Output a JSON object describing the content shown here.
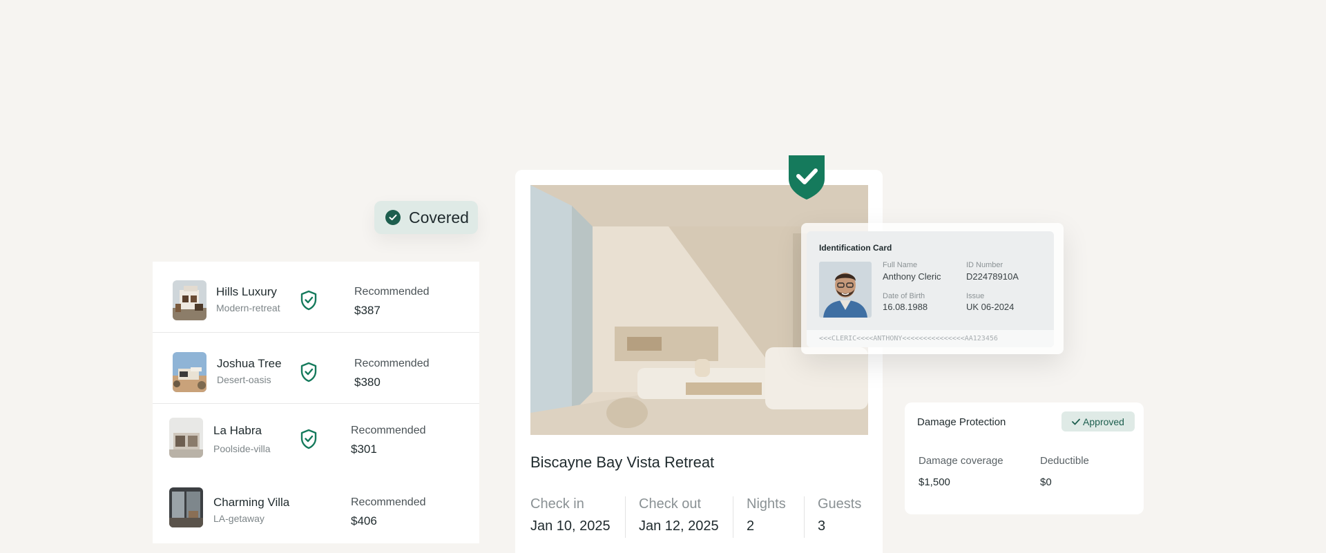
{
  "covered": {
    "label": "Covered"
  },
  "listings": [
    {
      "name": "Hills Luxury",
      "subtitle": "Modern-retreat",
      "recommended": "Recommended",
      "price": "$387",
      "covered": true
    },
    {
      "name": "Joshua Tree",
      "subtitle": "Desert-oasis",
      "recommended": "Recommended",
      "price": "$380",
      "covered": true
    },
    {
      "name": "La Habra",
      "subtitle": "Poolside-villa",
      "recommended": "Recommended",
      "price": "$301",
      "covered": true
    },
    {
      "name": "Charming Villa",
      "subtitle": "LA-getaway",
      "recommended": "Recommended",
      "price": "$406",
      "covered": false
    }
  ],
  "booking": {
    "title": "Biscayne Bay Vista Retreat",
    "check_in_label": "Check in",
    "check_in": "Jan 10, 2025",
    "check_out_label": "Check out",
    "check_out": "Jan 12, 2025",
    "nights_label": "Nights",
    "nights": "2",
    "guests_label": "Guests",
    "guests": "3"
  },
  "id_card": {
    "title": "Identification Card",
    "full_name_label": "Full Name",
    "full_name": "Anthony Cleric",
    "id_number_label": "ID Number",
    "id_number": "D22478910A",
    "dob_label": "Date of Birth",
    "dob": "16.08.1988",
    "issue_label": "Issue",
    "issue": "UK 06-2024",
    "mrz": "<<<CLERIC<<<<ANTHONY<<<<<<<<<<<<<<<AA123456"
  },
  "damage": {
    "title": "Damage Protection",
    "status": "Approved",
    "coverage_label": "Damage coverage",
    "coverage": "$1,500",
    "deductible_label": "Deductible",
    "deductible": "$0"
  },
  "colors": {
    "brand_green": "#157a5c",
    "badge_bg": "#dfeae6",
    "page_bg": "#f6f4f1"
  },
  "icons": [
    "check-circle-icon",
    "shield-check-icon",
    "check-icon"
  ]
}
